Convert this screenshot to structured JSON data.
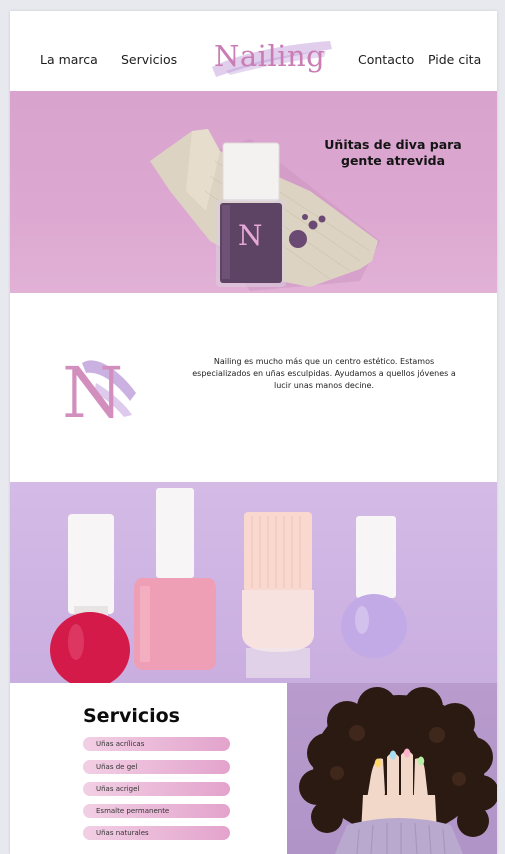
{
  "nav": {
    "links": [
      "La marca",
      "Servicios",
      "Contacto",
      "Pide cita"
    ],
    "logo_text": "Nailing"
  },
  "hero": {
    "title": "Uñitas de diva para gente atrevida",
    "bottle_letter": "N"
  },
  "about": {
    "logo_letter": "N",
    "text": "Nailing es mucho más que un centro estético. Estamos especializados en uñas esculpidas. Ayudamos a quellos jóvenes a lucir unas manos decine."
  },
  "services": {
    "title": "Servicios",
    "items": [
      "Uñas acrílicas",
      "Uñas de gel",
      "Uñas acrigel",
      "Esmalte permanente",
      "Uñas naturales"
    ]
  },
  "colors": {
    "brand": "#c97db4",
    "hero_bg": "#dca8d1",
    "lavender": "#c9aee0",
    "pill_start": "#f2cfe4",
    "pill_end": "#e3a3cc"
  }
}
